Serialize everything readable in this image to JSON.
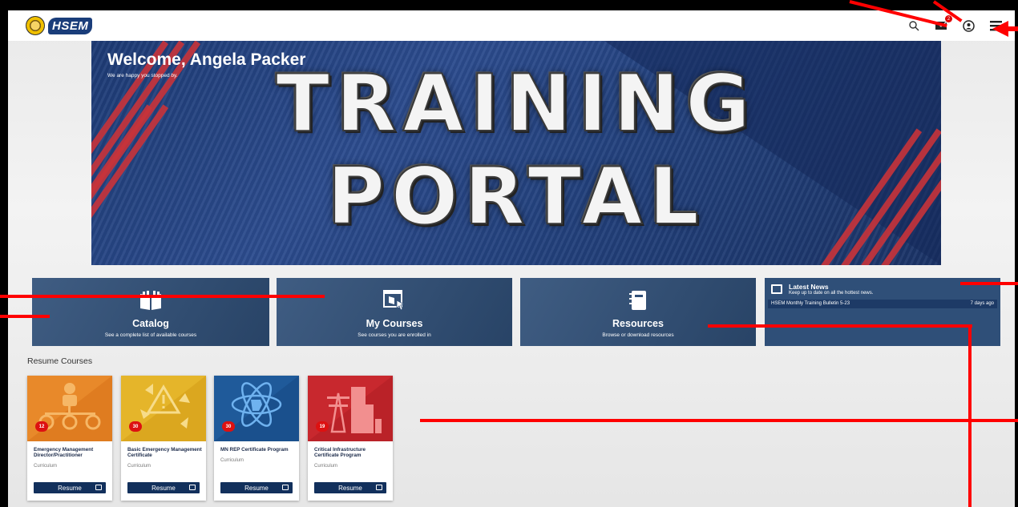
{
  "header": {
    "logo_text": "HSEM",
    "icons": [
      "search-icon",
      "mail-icon",
      "user-circle-icon",
      "hamburger-menu-icon"
    ],
    "mail_badge": "2"
  },
  "hero": {
    "welcome": "Welcome, Angela Packer",
    "subtitle": "We are happy you stopped by.",
    "title_line1": "TRAINING",
    "title_line2": "PORTAL"
  },
  "tiles": [
    {
      "title": "Catalog",
      "subtitle": "See a complete list of available courses",
      "icon": "book-open-icon"
    },
    {
      "title": "My Courses",
      "subtitle": "See courses you are enrolled in",
      "icon": "cursor-window-icon"
    },
    {
      "title": "Resources",
      "subtitle": "Browse or download resources",
      "icon": "notebook-icon"
    }
  ],
  "news": {
    "title": "Latest News",
    "subtitle": "Keep up to date on all the hottest news.",
    "item": "HSEM Monthly Training Bulletin 5-23",
    "item_age": "7 days ago"
  },
  "resume": {
    "heading": "Resume Courses",
    "cards": [
      {
        "title": "Emergency Management Director/Practitioner",
        "type": "Curriculum",
        "count": "12",
        "button": "Resume",
        "color": "#e8892a"
      },
      {
        "title": "Basic Emergency Management Certificate",
        "type": "Curriculum",
        "count": "30",
        "button": "Resume",
        "color": "#e5b52a"
      },
      {
        "title": "MN REP Certificate Program",
        "type": "Curriculum",
        "count": "30",
        "button": "Resume",
        "color": "#1f5a9a"
      },
      {
        "title": "Critical Infrastructure Certificate Program",
        "type": "Curriculum",
        "count": "19",
        "button": "Resume",
        "color": "#c8282e"
      }
    ]
  }
}
